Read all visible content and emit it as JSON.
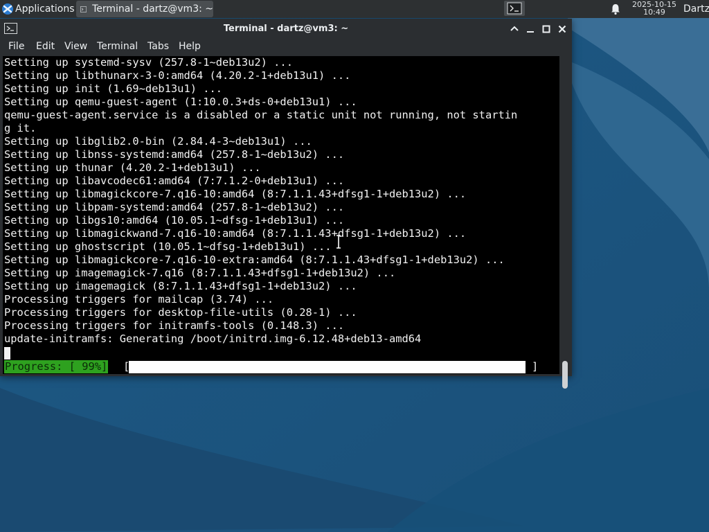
{
  "panel": {
    "applications_label": "Applications",
    "task_title": "Terminal - dartz@vm3: ~",
    "clock_date": "2025-10-15",
    "clock_time": "10:49",
    "user": "Dartz"
  },
  "window": {
    "title": "Terminal - dartz@vm3: ~",
    "menu": [
      "File",
      "Edit",
      "View",
      "Terminal",
      "Tabs",
      "Help"
    ]
  },
  "terminal": {
    "lines": [
      "Setting up systemd-sysv (257.8-1~deb13u2) ...",
      "Setting up libthunarx-3-0:amd64 (4.20.2-1+deb13u1) ...",
      "Setting up init (1.69~deb13u1) ...",
      "Setting up qemu-guest-agent (1:10.0.3+ds-0+deb13u1) ...",
      "qemu-guest-agent.service is a disabled or a static unit not running, not startin",
      "g it.",
      "Setting up libglib2.0-bin (2.84.4-3~deb13u1) ...",
      "Setting up libnss-systemd:amd64 (257.8-1~deb13u2) ...",
      "Setting up thunar (4.20.2-1+deb13u1) ...",
      "Setting up libavcodec61:amd64 (7:7.1.2-0+deb13u1) ...",
      "Setting up libmagickcore-7.q16-10:amd64 (8:7.1.1.43+dfsg1-1+deb13u2) ...",
      "Setting up libpam-systemd:amd64 (257.8-1~deb13u2) ...",
      "Setting up libgs10:amd64 (10.05.1~dfsg-1+deb13u1) ...",
      "Setting up libmagickwand-7.q16-10:amd64 (8:7.1.1.43+dfsg1-1+deb13u2) ...",
      "Setting up ghostscript (10.05.1~dfsg-1+deb13u1) ...",
      "Setting up libmagickcore-7.q16-10-extra:amd64 (8:7.1.1.43+dfsg1-1+deb13u2) ...",
      "Setting up imagemagick-7.q16 (8:7.1.1.43+dfsg1-1+deb13u2) ...",
      "Setting up imagemagick (8:7.1.1.43+dfsg1-1+deb13u2) ...",
      "Processing triggers for mailcap (3.74) ...",
      "Processing triggers for desktop-file-utils (0.28-1) ...",
      "Processing triggers for initramfs-tools (0.148.3) ...",
      "update-initramfs: Generating /boot/initrd.img-6.12.48+deb13-amd64"
    ],
    "progress_label": "Progress: [ 99%]",
    "progress_open": "[",
    "progress_close": "]",
    "progress_fraction": 0.99
  },
  "colors": {
    "progress_green": "#2ea11f",
    "panel_bg": "#2d3032",
    "wallpaper_blue": "#1f5f8f"
  }
}
